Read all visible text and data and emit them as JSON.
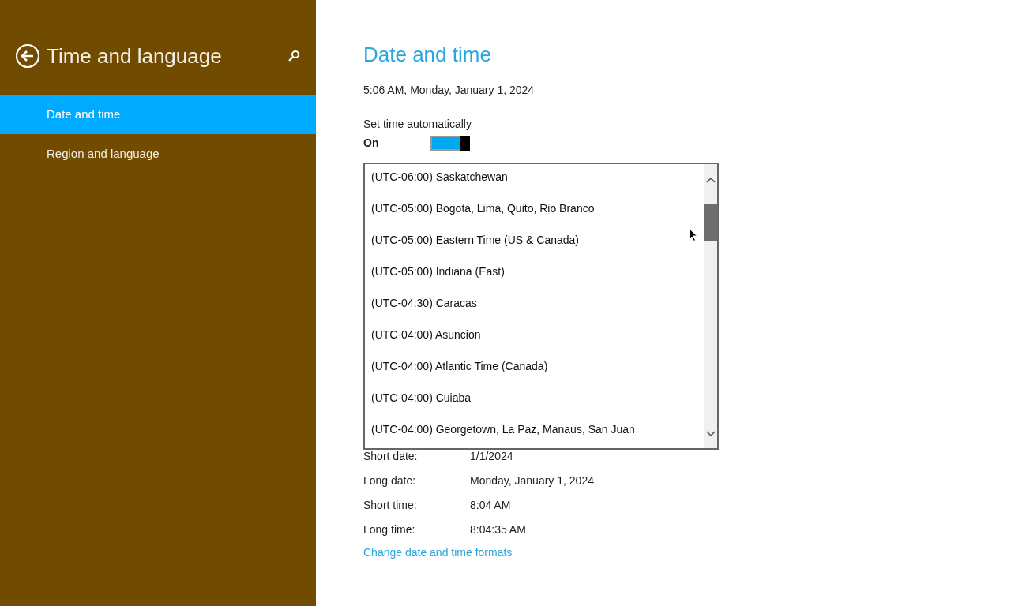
{
  "sidebar": {
    "title": "Time and language",
    "items": [
      {
        "label": "Date and time",
        "selected": true
      },
      {
        "label": "Region and language",
        "selected": false
      }
    ]
  },
  "main": {
    "title": "Date and time",
    "current_time": "5:06 AM, Monday, January 1, 2024",
    "auto_time": {
      "label": "Set time automatically",
      "state_text": "On",
      "on": true
    },
    "timezone_list": {
      "items": [
        "(UTC-06:00) Saskatchewan",
        "(UTC-05:00) Bogota, Lima, Quito, Rio Branco",
        "(UTC-05:00) Eastern Time (US & Canada)",
        "(UTC-05:00) Indiana (East)",
        "(UTC-04:30) Caracas",
        "(UTC-04:00) Asuncion",
        "(UTC-04:00) Atlantic Time (Canada)",
        "(UTC-04:00) Cuiaba",
        "(UTC-04:00) Georgetown, La Paz, Manaus, San Juan"
      ]
    },
    "formats": [
      {
        "label": "Short date:",
        "value": "1/1/2024"
      },
      {
        "label": "Long date:",
        "value": "Monday, January 1, 2024"
      },
      {
        "label": "Short time:",
        "value": "8:04 AM"
      },
      {
        "label": "Long time:",
        "value": "8:04:35 AM"
      }
    ],
    "link": "Change date and time formats"
  }
}
